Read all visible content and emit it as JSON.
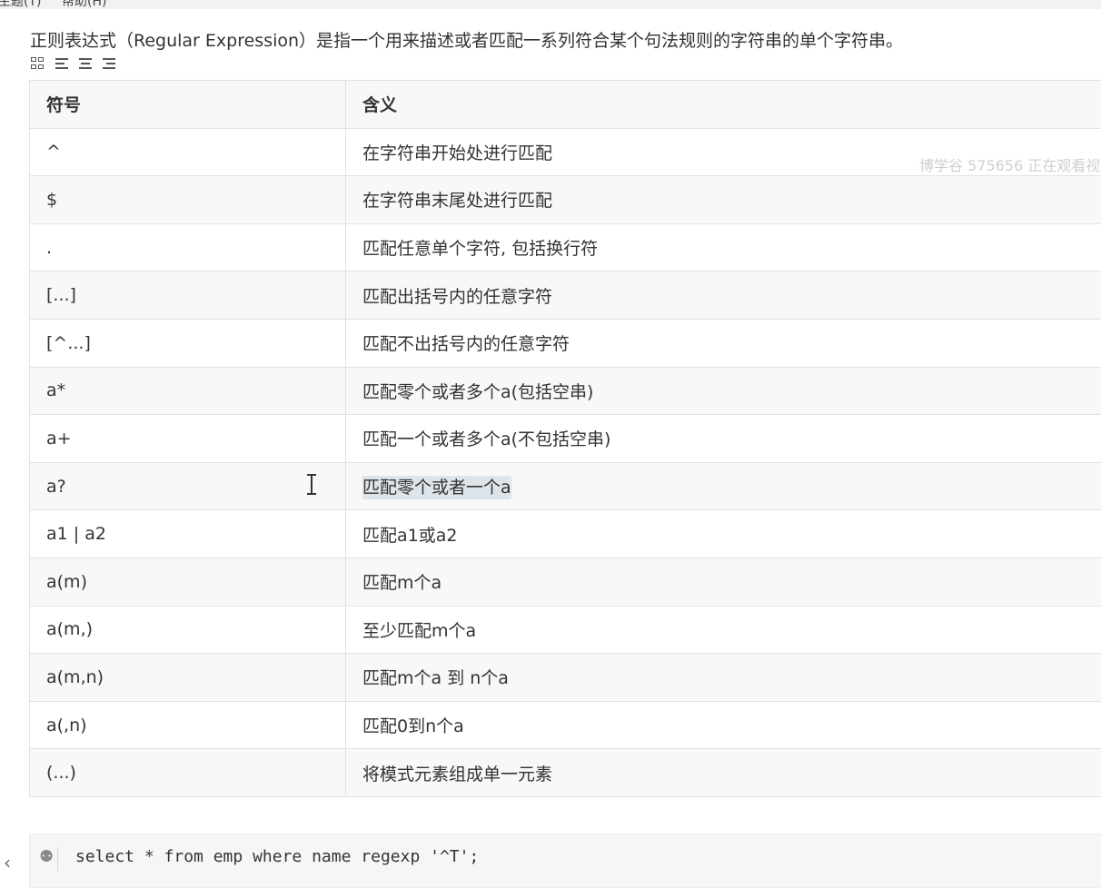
{
  "menubar": {
    "items": [
      "主题(T)",
      "帮助(H)"
    ]
  },
  "intro_text": "正则表达式（Regular Expression）是指一个用来描述或者匹配一系列符合某个句法规则的字符串的单个字符串。",
  "watermark": "博学谷 575656 正在观看视",
  "table": {
    "headers": [
      "符号",
      "含义"
    ],
    "rows": [
      {
        "symbol": "^",
        "meaning": "在字符串开始处进行匹配"
      },
      {
        "symbol": "$",
        "meaning": "在字符串末尾处进行匹配"
      },
      {
        "symbol": ".",
        "meaning": "匹配任意单个字符, 包括换行符"
      },
      {
        "symbol": "[...]",
        "meaning": "匹配出括号内的任意字符"
      },
      {
        "symbol": "[^...]",
        "meaning": "匹配不出括号内的任意字符"
      },
      {
        "symbol": "a*",
        "meaning": "匹配零个或者多个a(包括空串)"
      },
      {
        "symbol": "a+",
        "meaning": "匹配一个或者多个a(不包括空串)"
      },
      {
        "symbol": "a?",
        "meaning": "匹配零个或者一个a"
      },
      {
        "symbol": "a1 | a2",
        "meaning": "匹配a1或a2"
      },
      {
        "symbol": "a(m)",
        "meaning": "匹配m个a"
      },
      {
        "symbol": "a(m,)",
        "meaning": "至少匹配m个a"
      },
      {
        "symbol": "a(m,n)",
        "meaning": "匹配m个a 到 n个a"
      },
      {
        "symbol": "a(,n)",
        "meaning": "匹配0到n个a"
      },
      {
        "symbol": "(...)",
        "meaning": "将模式元素组成单一元素"
      }
    ],
    "selected_row": 7
  },
  "code": {
    "text": "select * from emp where name regexp '^T';"
  },
  "nav": {
    "left_arrow": "‹"
  },
  "colors": {
    "selection": "#dde4ea",
    "border": "#dfe2e5",
    "alt_row": "#f8f8f8"
  }
}
